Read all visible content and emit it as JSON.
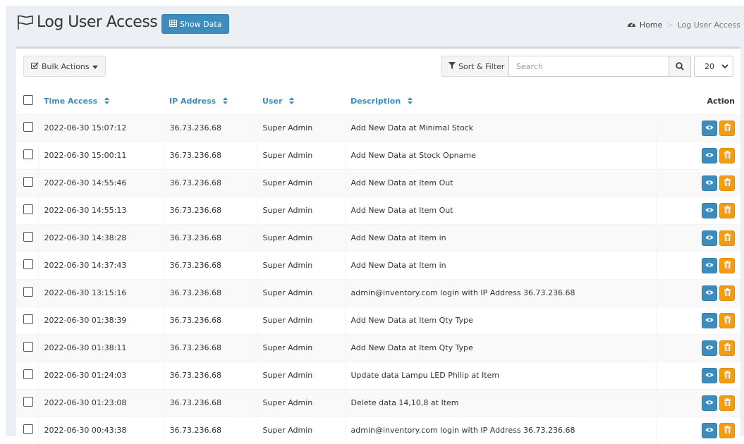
{
  "header": {
    "title": "Log User Access",
    "show_data_label": "Show Data"
  },
  "breadcrumb": {
    "home": "Home",
    "current": "Log User Access"
  },
  "toolbar": {
    "bulk_actions_label": "Bulk Actions",
    "sort_filter_label": "Sort & Filter",
    "search_placeholder": "Search",
    "per_page_value": "20"
  },
  "table": {
    "columns": {
      "time_access": "Time Access",
      "ip_address": "IP Address",
      "user": "User",
      "description": "Description",
      "action": "Action"
    },
    "rows": [
      {
        "time": "2022-06-30 15:07:12",
        "ip": "36.73.236.68",
        "user": "Super Admin",
        "description": "Add New Data at Minimal Stock"
      },
      {
        "time": "2022-06-30 15:00:11",
        "ip": "36.73.236.68",
        "user": "Super Admin",
        "description": "Add New Data at Stock Opname"
      },
      {
        "time": "2022-06-30 14:55:46",
        "ip": "36.73.236.68",
        "user": "Super Admin",
        "description": "Add New Data at Item Out"
      },
      {
        "time": "2022-06-30 14:55:13",
        "ip": "36.73.236.68",
        "user": "Super Admin",
        "description": "Add New Data at Item Out"
      },
      {
        "time": "2022-06-30 14:38:28",
        "ip": "36.73.236.68",
        "user": "Super Admin",
        "description": "Add New Data at Item in"
      },
      {
        "time": "2022-06-30 14:37:43",
        "ip": "36.73.236.68",
        "user": "Super Admin",
        "description": "Add New Data at Item in"
      },
      {
        "time": "2022-06-30 13:15:16",
        "ip": "36.73.236.68",
        "user": "Super Admin",
        "description": "admin@inventory.com login with IP Address 36.73.236.68"
      },
      {
        "time": "2022-06-30 01:38:39",
        "ip": "36.73.236.68",
        "user": "Super Admin",
        "description": "Add New Data at Item Qty Type"
      },
      {
        "time": "2022-06-30 01:38:11",
        "ip": "36.73.236.68",
        "user": "Super Admin",
        "description": "Add New Data at Item Qty Type"
      },
      {
        "time": "2022-06-30 01:24:03",
        "ip": "36.73.236.68",
        "user": "Super Admin",
        "description": "Update data Lampu LED Philip at Item"
      },
      {
        "time": "2022-06-30 01:23:08",
        "ip": "36.73.236.68",
        "user": "Super Admin",
        "description": "Delete data 14,10,8 at Item"
      },
      {
        "time": "2022-06-30 00:43:38",
        "ip": "36.73.236.68",
        "user": "Super Admin",
        "description": "admin@inventory.com login with IP Address 36.73.236.68"
      }
    ]
  },
  "colors": {
    "primary": "#3c8dbc",
    "warning": "#f39c12",
    "background": "#ecf0f5"
  },
  "icons": {
    "title": "flag-icon",
    "show_data": "table-icon",
    "home": "dashboard-icon",
    "bulk": "checkbox-icon",
    "sort": "filter-icon",
    "search": "search-icon",
    "view": "eye-icon",
    "delete": "trash-icon"
  }
}
